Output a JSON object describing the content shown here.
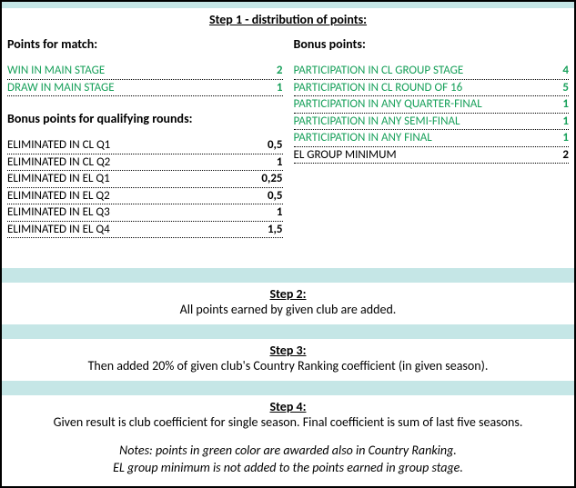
{
  "step1_title": "Step 1 - distribution of points:",
  "left": {
    "match_head": "Points for match:",
    "match_rows": [
      {
        "label": "WIN IN MAIN STAGE",
        "value": "2"
      },
      {
        "label": "DRAW IN MAIN STAGE",
        "value": "1"
      }
    ],
    "qual_head": "Bonus points for qualifying rounds:",
    "qual_rows": [
      {
        "label": "ELIMINATED IN CL Q1",
        "value": "0,5"
      },
      {
        "label": "ELIMINATED IN CL Q2",
        "value": "1"
      },
      {
        "label": "ELIMINATED IN EL Q1",
        "value": "0,25"
      },
      {
        "label": "ELIMINATED IN EL Q2",
        "value": "0,5"
      },
      {
        "label": "ELIMINATED IN EL Q3",
        "value": "1"
      },
      {
        "label": "ELIMINATED IN EL Q4",
        "value": "1,5"
      }
    ]
  },
  "right": {
    "bonus_head": "Bonus points:",
    "bonus_rows_green": [
      {
        "label": "PARTICIPATION IN CL GROUP STAGE",
        "value": "4"
      },
      {
        "label": "PARTICIPATION IN CL ROUND OF 16",
        "value": "5"
      },
      {
        "label": "PARTICIPATION IN ANY QUARTER-FINAL",
        "value": "1"
      },
      {
        "label": "PARTICIPATION IN ANY SEMI-FINAL",
        "value": "1"
      },
      {
        "label": "PARTICIPATION IN ANY FINAL",
        "value": "1"
      }
    ],
    "bonus_rows_black": [
      {
        "label": "EL GROUP MINIMUM",
        "value": "2"
      }
    ]
  },
  "step2_head": "Step 2:",
  "step2_text": "All points earned by given club are added.",
  "step3_head": "Step 3:",
  "step3_text": "Then added 20% of given club's Country Ranking coefficient (in given season).",
  "step4_head": "Step 4:",
  "step4_text": "Given result is club coefficient for single season. Final coefficient is sum of last five seasons.",
  "note1": "Notes: points in green color are awarded also in Country Ranking.",
  "note2": "EL group minimum is not added to the points earned in group stage."
}
